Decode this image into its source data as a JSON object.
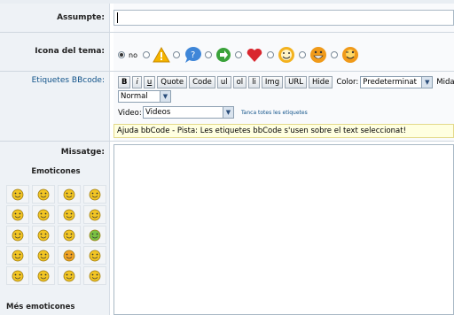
{
  "subject": {
    "label": "Assumpte:",
    "value": ""
  },
  "topic_icon": {
    "label": "Icona del tema:",
    "no_option": "no",
    "icons": [
      {
        "name": "warning-icon",
        "color": "#f4b400"
      },
      {
        "name": "question-icon",
        "color": "#3f86d8"
      },
      {
        "name": "arrow-circle-icon",
        "color": "#3aa23a"
      },
      {
        "name": "heart-icon",
        "color": "#d9262e"
      },
      {
        "name": "smile-icon",
        "color": "#f3b21f"
      },
      {
        "name": "grin-icon",
        "color": "#f09a1a"
      },
      {
        "name": "wink-icon",
        "color": "#f09a1a"
      }
    ]
  },
  "bbcode": {
    "label": "Etiquetes BBcode:",
    "buttons": [
      "B",
      "i",
      "u",
      "Quote",
      "Code",
      "ul",
      "ol",
      "li",
      "Img",
      "URL",
      "Hide"
    ],
    "color_label": "Color:",
    "color_value": "Predeterminat",
    "size_label": "Mida",
    "size_value": "Normal",
    "video_label": "Video:",
    "video_value": "Videos",
    "close_tags": "Tanca totes les etiquetes",
    "hint": "Ajuda bbCode - Pista: Les etiquetes bbCode s'usen sobre el text seleccionat!"
  },
  "message": {
    "label": "Missatge:",
    "value": ""
  },
  "emoticons": {
    "title": "Emoticones",
    "more": "Més emoticones",
    "items": [
      {
        "name": "cool-smiley-icon",
        "color": "#f2c524"
      },
      {
        "name": "confused-smiley-icon",
        "color": "#f2c524"
      },
      {
        "name": "smile-smiley-icon",
        "color": "#f2c524"
      },
      {
        "name": "grin-smiley-icon",
        "color": "#f2c524"
      },
      {
        "name": "happy-smiley-icon",
        "color": "#f2c524"
      },
      {
        "name": "neutral-smiley-icon",
        "color": "#f2c524"
      },
      {
        "name": "tongue-smiley-icon",
        "color": "#f2c524"
      },
      {
        "name": "squint-smiley-icon",
        "color": "#f2c524"
      },
      {
        "name": "surprised-smiley-icon",
        "color": "#f2c524"
      },
      {
        "name": "shocked-smiley-icon",
        "color": "#f2c524"
      },
      {
        "name": "eyes-smiley-icon",
        "color": "#f2c524"
      },
      {
        "name": "sick-smiley-icon",
        "color": "#7ac143"
      },
      {
        "name": "mad-smiley-icon",
        "color": "#f2c524"
      },
      {
        "name": "wink-smiley-icon",
        "color": "#f2c524"
      },
      {
        "name": "blush-smiley-icon",
        "color": "#f2a324"
      },
      {
        "name": "sad-smiley-icon",
        "color": "#f2c524"
      },
      {
        "name": "laugh-smiley-icon",
        "color": "#f2c524"
      },
      {
        "name": "bored-smiley-icon",
        "color": "#f2c524"
      },
      {
        "name": "evil-smiley-icon",
        "color": "#f2c524"
      },
      {
        "name": "crazy-smiley-icon",
        "color": "#f2c524"
      }
    ]
  }
}
